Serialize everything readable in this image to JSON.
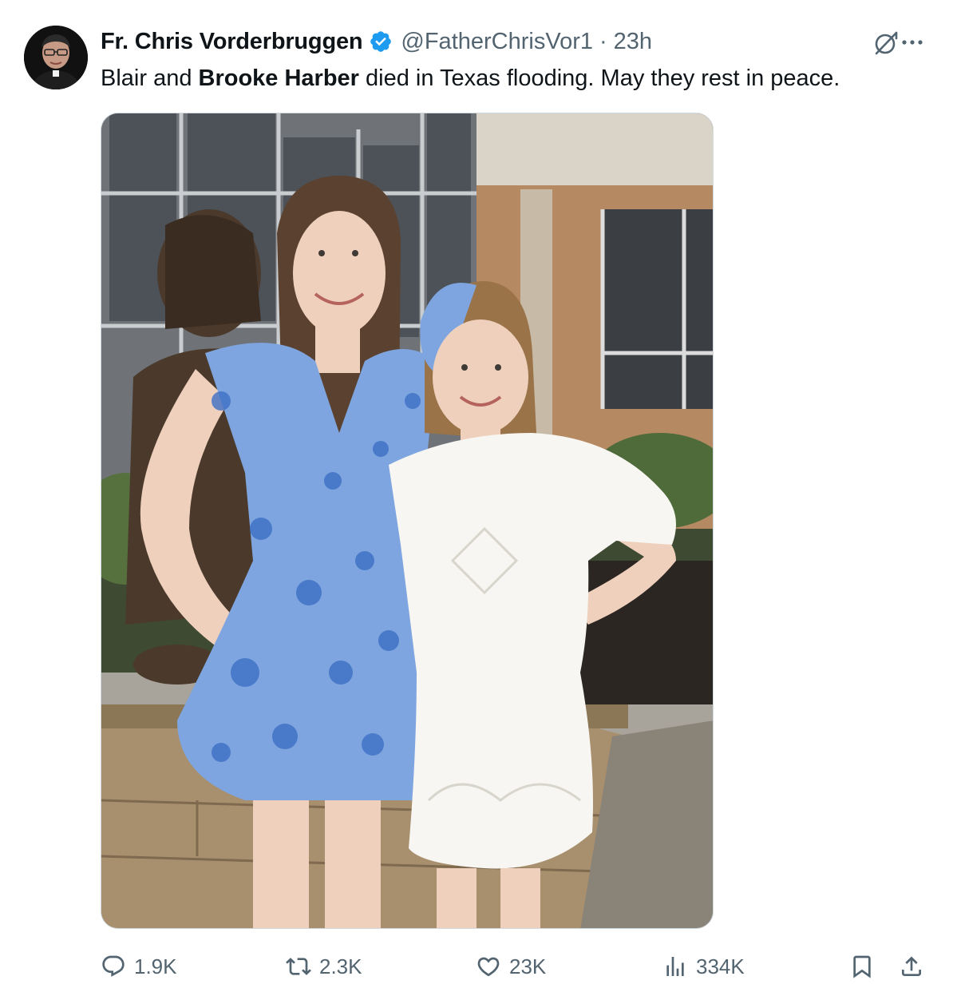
{
  "tweet": {
    "author_name": "Fr. Chris Vorderbruggen",
    "handle": "@FatherChrisVor1",
    "separator": "·",
    "time": "23h",
    "text_before": "Blair and ",
    "text_bold": "Brooke Harber",
    "text_after": " died in Texas flooding. May they rest in peace.",
    "verified_color": "#1d9bf0"
  },
  "actions": {
    "replies": "1.9K",
    "reposts": "2.3K",
    "likes": "23K",
    "views": "334K"
  },
  "icons": {
    "grok": "grok-icon",
    "more": "more-dots-icon",
    "reply": "reply-icon",
    "repost": "repost-icon",
    "like": "heart-icon",
    "views": "views-chart-icon",
    "bookmark": "bookmark-icon",
    "share": "share-icon"
  },
  "colors": {
    "text_primary": "#0f1419",
    "text_secondary": "#536471",
    "border": "#cfd9de"
  }
}
